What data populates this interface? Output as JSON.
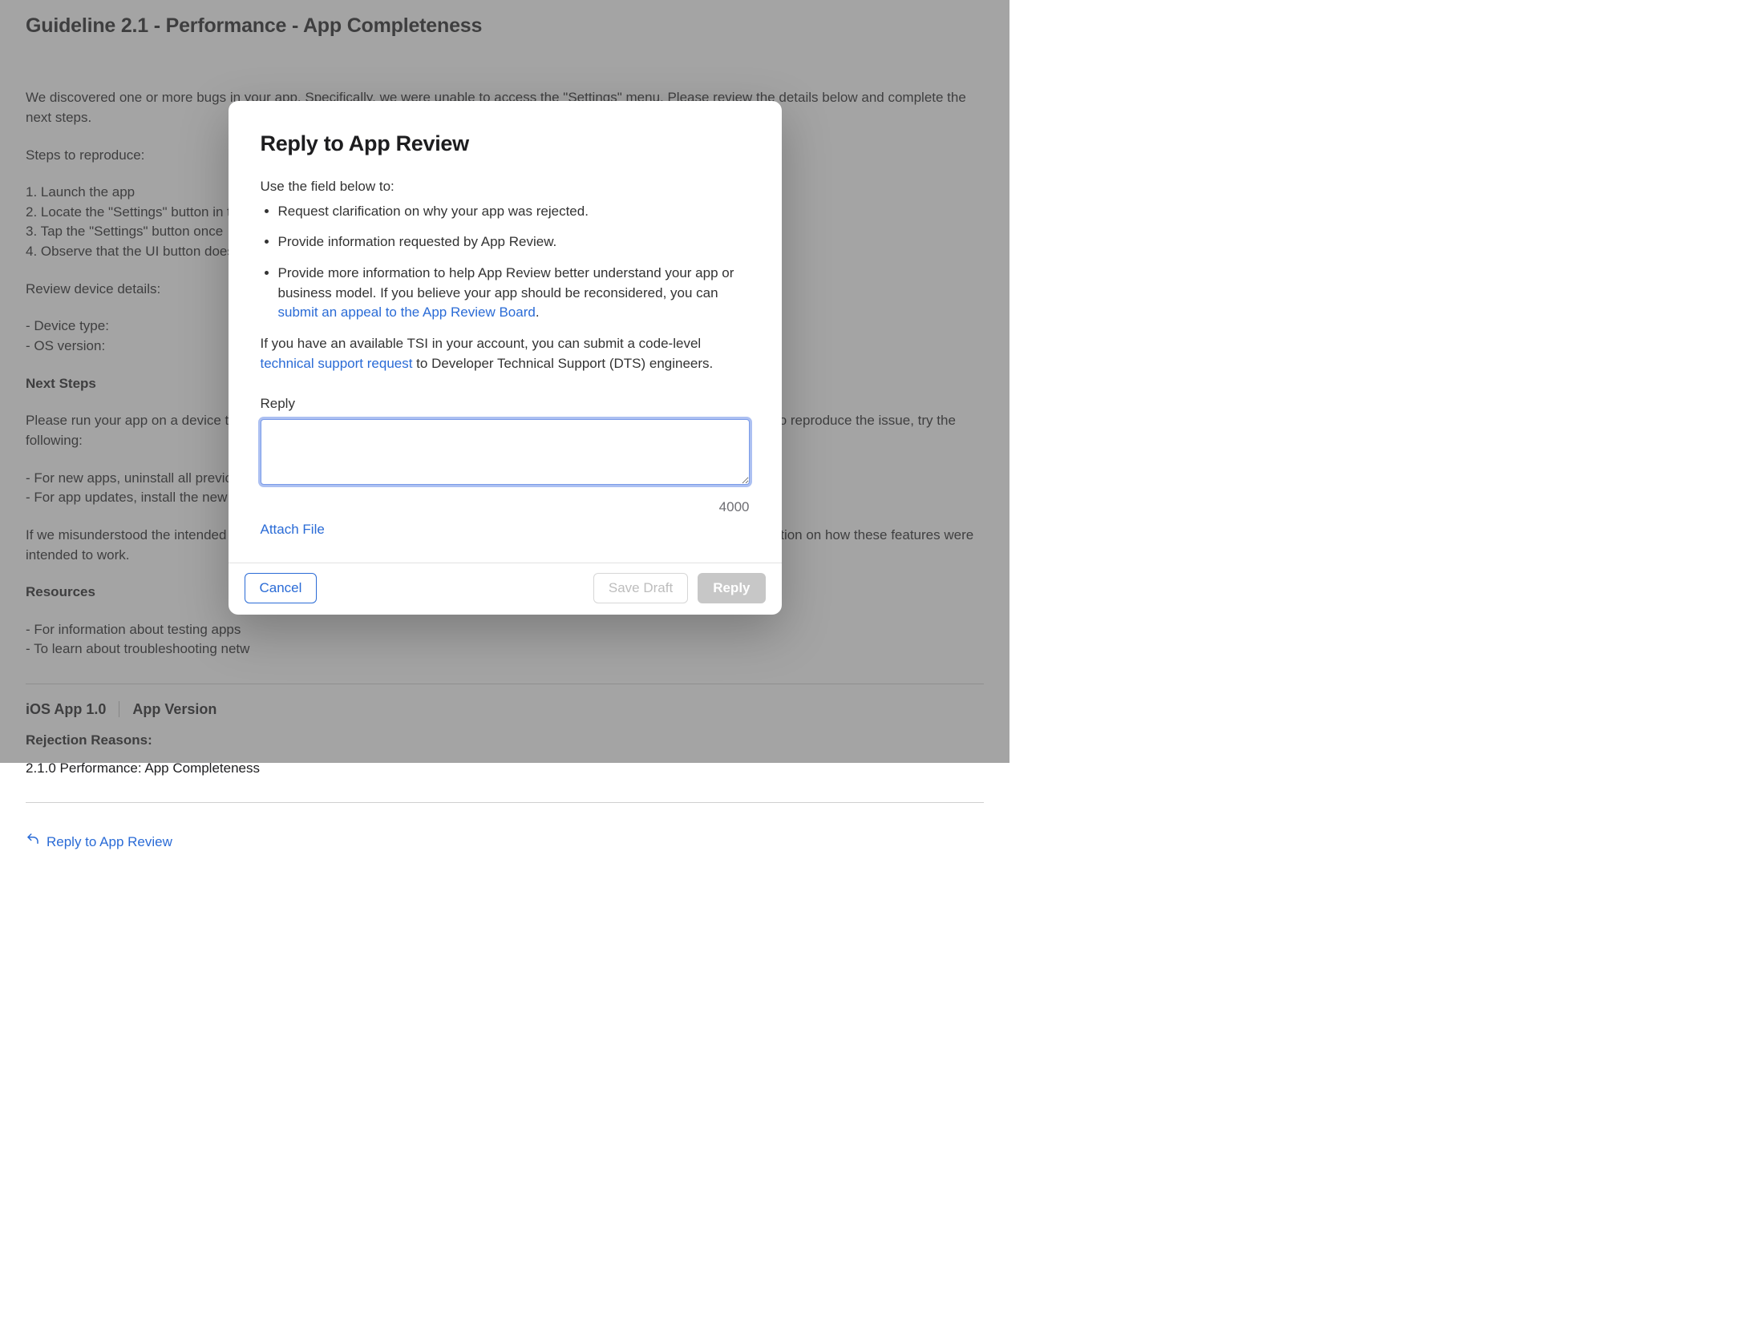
{
  "bg": {
    "heading": "Guideline 2.1 - Performance - App Completeness",
    "intro": "We discovered one or more bugs in your app. Specifically, we were unable to access the \"Settings\" menu. Please review the details below and complete the next steps.",
    "steps_title": "Steps to reproduce:",
    "steps": [
      "1. Launch the app",
      "2. Locate the \"Settings\" button in the",
      "3. Tap the \"Settings\" button once",
      "4. Observe that the UI button does n"
    ],
    "device_title": "Review device details:",
    "device_lines": [
      "- Device type:",
      "- OS version:"
    ],
    "next_title": "Next Steps",
    "next_intro": "Please run your app on a device to reproduce the issues, then revise and submit your app for review. If at first you're unable to reproduce the issue, try the following:",
    "next_lines": [
      "- For new apps, uninstall all previous",
      "- For app updates, install the new ve"
    ],
    "next_misunder": "If we misunderstood the intended behavior of your app, please reply to this message in App Store Connect to provide information on how these features were intended to work.",
    "resources_title": "Resources",
    "resources_lines": [
      "- For information about testing apps",
      "- To learn about troubleshooting netw"
    ],
    "meta": {
      "app": "iOS App 1.0",
      "version_label": "App Version"
    },
    "rejection": {
      "title": "Rejection Reasons:",
      "item": "2.1.0 Performance: App Completeness"
    },
    "reply_link": "Reply to App Review"
  },
  "modal": {
    "title": "Reply to App Review",
    "intro": "Use the field below to:",
    "bullets": {
      "b1": "Request clarification on why your app was rejected.",
      "b2": "Provide information requested by App Review.",
      "b3_pre": "Provide more information to help App Review better understand your app or business model. If you believe your app should be reconsidered, you can ",
      "b3_link": "submit an appeal to the App Review Board",
      "b3_post": "."
    },
    "tsi_pre": "If you have an available TSI in your account, you can submit a code-level ",
    "tsi_link": "technical support request",
    "tsi_post": " to Developer Technical Support (DTS) engineers.",
    "field_label": "Reply",
    "counter": "4000",
    "attach": "Attach File",
    "buttons": {
      "cancel": "Cancel",
      "save": "Save Draft",
      "reply": "Reply"
    }
  }
}
